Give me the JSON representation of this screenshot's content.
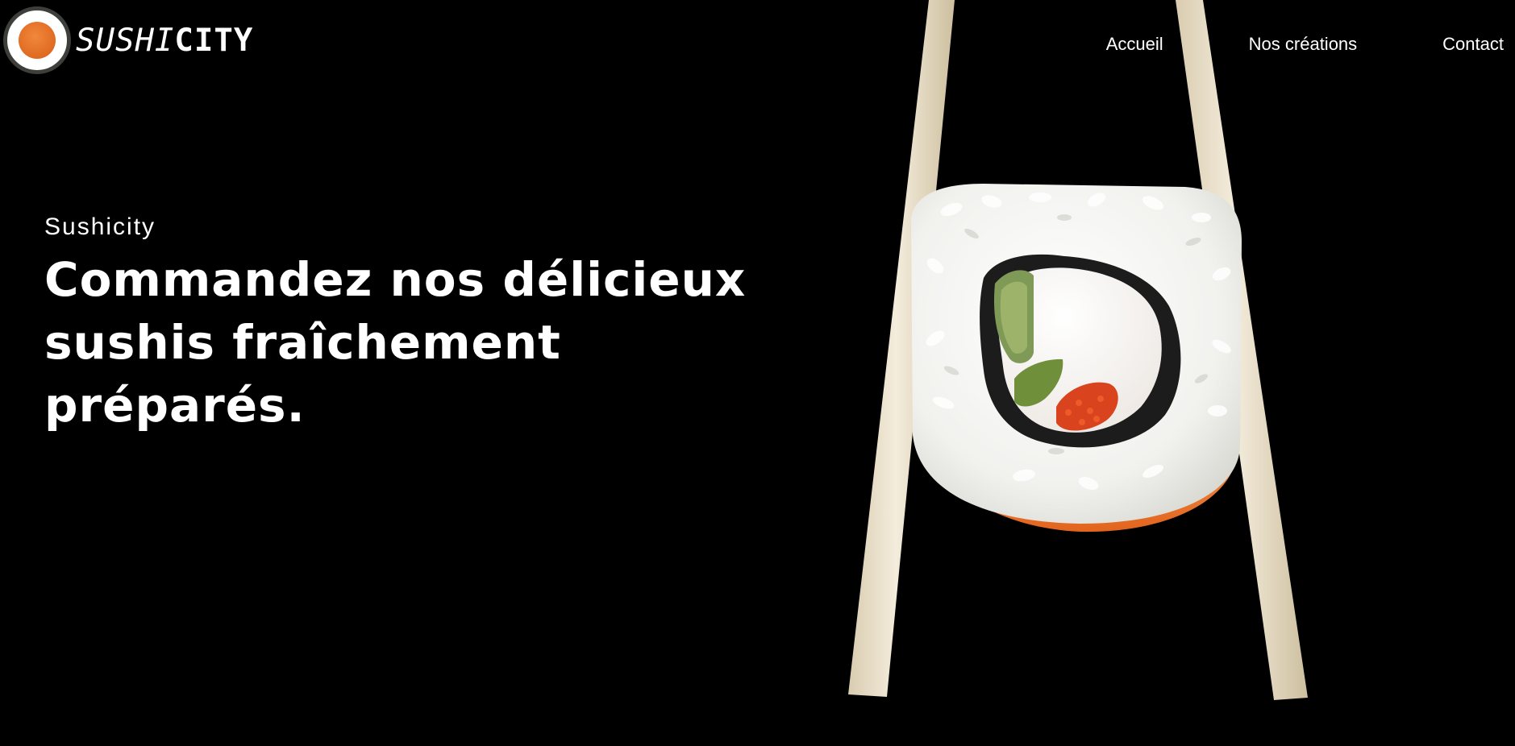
{
  "brand": {
    "name_part1": "SUSHI",
    "name_part2": "CITY",
    "logo_icon": "sushi-roll-logo-icon",
    "accent_color": "#e06a22"
  },
  "nav": {
    "items": [
      {
        "label": "Accueil"
      },
      {
        "label": "Nos créations"
      },
      {
        "label": "Contact"
      }
    ]
  },
  "hero": {
    "eyebrow": "Sushicity",
    "headline": "Commandez nos délicieux sushis fraîchement préparés.",
    "image": "sushi-roll-with-chopsticks-illustration",
    "background_color": "#000000"
  }
}
